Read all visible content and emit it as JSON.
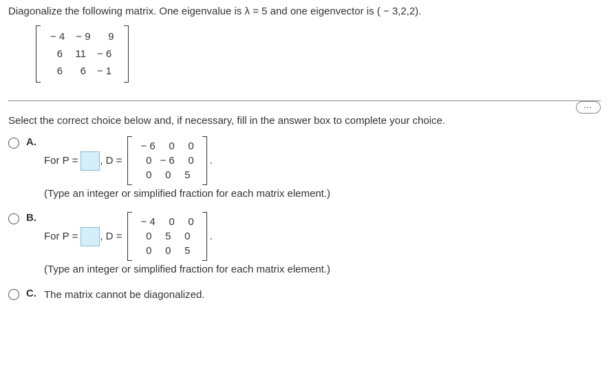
{
  "question": "Diagonalize the following matrix. One eigenvalue is λ = 5 and one eigenvector is ( − 3,2,2).",
  "matrix_A": {
    "rows": [
      [
        "− 4",
        "− 9",
        "9"
      ],
      [
        "6",
        "11",
        "− 6"
      ],
      [
        "6",
        "6",
        "− 1"
      ]
    ]
  },
  "instruction": "Select the correct choice below and, if necessary, fill in the answer box to complete your choice.",
  "ellipsis": "⋯",
  "choices": {
    "A": {
      "label": "A.",
      "prefix": "For P =",
      "mid": ", D =",
      "D_matrix": {
        "rows": [
          [
            "− 6",
            "0",
            "0"
          ],
          [
            "0",
            "− 6",
            "0"
          ],
          [
            "0",
            "0",
            "5"
          ]
        ]
      },
      "period": ".",
      "hint": "(Type an integer or simplified fraction for each matrix element.)"
    },
    "B": {
      "label": "B.",
      "prefix": "For P =",
      "mid": ", D =",
      "D_matrix": {
        "rows": [
          [
            "− 4",
            "0",
            "0"
          ],
          [
            "0",
            "5",
            "0"
          ],
          [
            "0",
            "0",
            "5"
          ]
        ]
      },
      "period": ".",
      "hint": "(Type an integer or simplified fraction for each matrix element.)"
    },
    "C": {
      "label": "C.",
      "text": "The matrix cannot be diagonalized."
    }
  }
}
